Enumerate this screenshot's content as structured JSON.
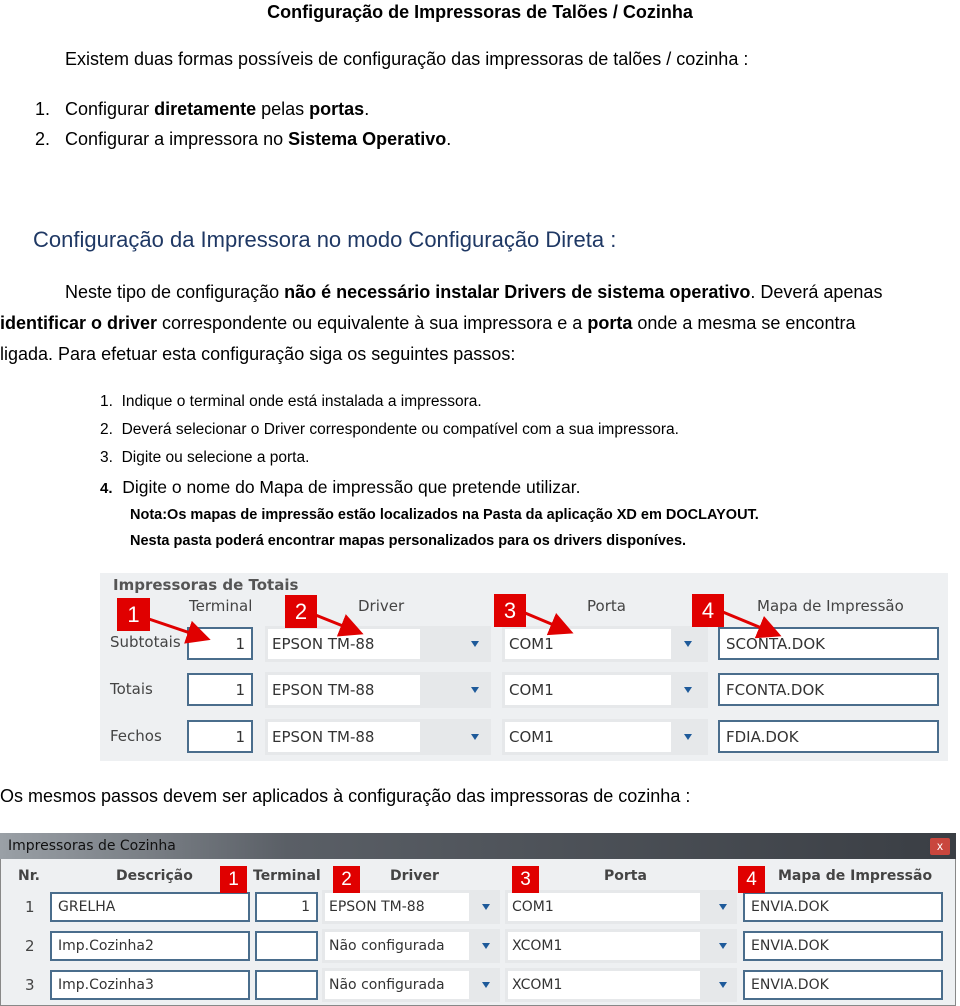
{
  "title": "Configuração de Impressoras de Talões / Cozinha",
  "intro": "Existem duas formas possíveis de configuração das impressoras de talões / cozinha :",
  "methods": [
    {
      "num": "1.",
      "pre": "Configurar ",
      "b1": "diretamente",
      "mid": " pelas ",
      "b2": "portas",
      "post": "."
    },
    {
      "num": "2.",
      "pre": "Configurar a impressora no ",
      "b1": "Sistema Operativo",
      "post": "."
    }
  ],
  "section_heading": "Configuração da Impressora no modo Configuração Direta :",
  "para": {
    "l1a": "Neste tipo de configuração ",
    "l1b": "não é necessário instalar Drivers de sistema operativo",
    "l1c": ". Deverá apenas",
    "l2a": "identificar o driver",
    "l2b": " correspondente ou equivalente à sua impressora e a ",
    "l2c": "porta",
    "l2d": " onde a mesma se encontra",
    "l3": "ligada. Para efetuar esta configuração siga os seguintes passos:"
  },
  "steps": [
    {
      "num": "1.",
      "text": "Indique o terminal onde está instalada a impressora."
    },
    {
      "num": "2.",
      "text": "Deverá selecionar o Driver correspondente ou compatível com a sua impressora."
    },
    {
      "num": "3.",
      "text": "Digite ou selecione a porta."
    },
    {
      "num": "4.",
      "text": "Digite o nome do Mapa de impressão que pretende utilizar."
    }
  ],
  "notes": [
    "Nota:Os mapas de impressão estão localizados na Pasta da aplicação XD em DOCLAYOUT.",
    "Nesta pasta poderá encontrar mapas personalizados para os drivers disponíves."
  ],
  "totais": {
    "title": "Impressoras de Totais",
    "headers": {
      "terminal": "Terminal",
      "driver": "Driver",
      "porta": "Porta",
      "mapa": "Mapa de Impressão"
    },
    "badges": [
      "1",
      "2",
      "3",
      "4"
    ],
    "rows": [
      {
        "label": "Subtotais",
        "terminal": "1",
        "driver": "EPSON TM-88",
        "porta": "COM1",
        "mapa": "SCONTA.DOK"
      },
      {
        "label": "Totais",
        "terminal": "1",
        "driver": "EPSON TM-88",
        "porta": "COM1",
        "mapa": "FCONTA.DOK"
      },
      {
        "label": "Fechos",
        "terminal": "1",
        "driver": "EPSON TM-88",
        "porta": "COM1",
        "mapa": "FDIA.DOK"
      }
    ]
  },
  "same_steps": "Os mesmos passos devem ser aplicados à configuração das impressoras de cozinha :",
  "cozinha": {
    "title": "Impressoras de Cozinha",
    "close": "x",
    "headers": {
      "nr": "Nr.",
      "descricao": "Descrição",
      "terminal": "Terminal",
      "driver": "Driver",
      "porta": "Porta",
      "mapa": "Mapa de Impressão"
    },
    "badges": [
      "1",
      "2",
      "3",
      "4"
    ],
    "rows": [
      {
        "nr": "1",
        "descricao": "GRELHA",
        "terminal": "1",
        "driver": "EPSON TM-88",
        "porta": "COM1",
        "mapa": "ENVIA.DOK"
      },
      {
        "nr": "2",
        "descricao": "Imp.Cozinha2",
        "terminal": "",
        "driver": "Não configurada",
        "porta": "XCOM1",
        "mapa": "ENVIA.DOK"
      },
      {
        "nr": "3",
        "descricao": "Imp.Cozinha3",
        "terminal": "",
        "driver": "Não configurada",
        "porta": "XCOM1",
        "mapa": "ENVIA.DOK"
      }
    ]
  },
  "colors": {
    "badge": "#e00000",
    "heading": "#1f3864",
    "field_border": "#4a6d8c"
  }
}
